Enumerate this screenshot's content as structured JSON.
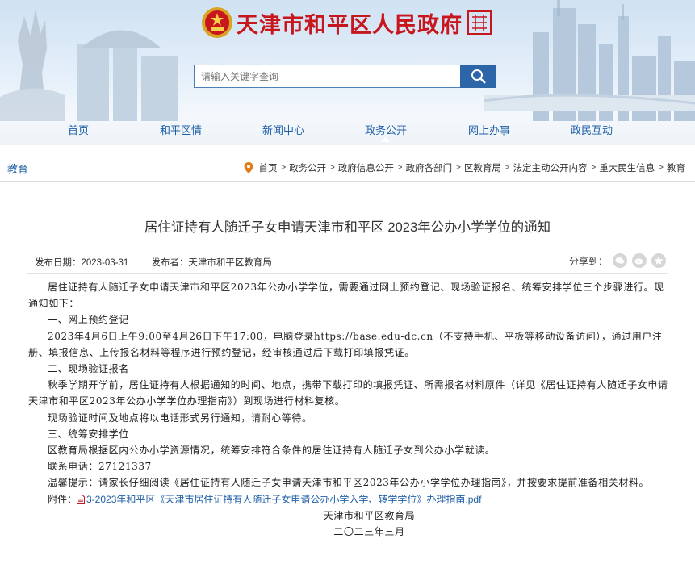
{
  "header": {
    "site_title": "天津市和平区人民政府",
    "search_placeholder": "请输入关键字查询",
    "nav": [
      {
        "label": "首页"
      },
      {
        "label": "和平区情"
      },
      {
        "label": "新闻中心"
      },
      {
        "label": "政务公开",
        "active": true
      },
      {
        "label": "网上办事"
      },
      {
        "label": "政民互动"
      }
    ],
    "colors": {
      "title_red": "#c8161d",
      "nav_blue": "#1f5fa6",
      "search_button": "#2c66a8"
    }
  },
  "breadcrumb": {
    "section": "教育",
    "items": [
      "首页",
      "政务公开",
      "政府信息公开",
      "政府各部门",
      "区教育局",
      "法定主动公开内容",
      "重大民生信息",
      "教育"
    ],
    "separator": ">"
  },
  "article": {
    "title": "居住证持有人随迁子女申请天津市和平区 2023年公办小学学位的通知",
    "publish_date": "发布日期：2023-03-31",
    "publisher": "发布者：天津市和平区教育局",
    "share_label": "分享到：",
    "share_icons": [
      "wechat-icon",
      "weibo-icon",
      "favorite-icon"
    ],
    "paragraphs": [
      "居住证持有人随迁子女申请天津市和平区2023年公办小学学位，需要通过网上预约登记、现场验证报名、统筹安排学位三个步骤进行。现通知如下：",
      "一、网上预约登记",
      "2023年4月6日上午9:00至4月26日下午17:00，电脑登录https://base.edu-dc.cn（不支持手机、平板等移动设备访问），通过用户注册、填报信息、上传报名材料等程序进行预约登记，经审核通过后下载打印填报凭证。",
      "二、现场验证报名",
      "秋季学期开学前，居住证持有人根据通知的时间、地点，携带下载打印的填报凭证、所需报名材料原件（详见《居住证持有人随迁子女申请天津市和平区2023年公办小学学位办理指南》）到现场进行材料复核。",
      "现场验证时间及地点将以电话形式另行通知，请耐心等待。",
      "三、统筹安排学位",
      "区教育局根据区内公办小学资源情况，统筹安排符合条件的居住证持有人随迁子女到公办小学就读。",
      "联系电话：27121337",
      "温馨提示：请家长仔细阅读《居住证持有人随迁子女申请天津市和平区2023年公办小学学位办理指南》，并按要求提前准备相关材料。"
    ],
    "attachment_label": "附件：",
    "attachment_name": "3-2023年和平区《天津市居住证持有人随迁子女申请公办小学入学、转学学位》办理指南.pdf",
    "signature": "天津市和平区教育局",
    "date_line": "二〇二三年三月"
  }
}
